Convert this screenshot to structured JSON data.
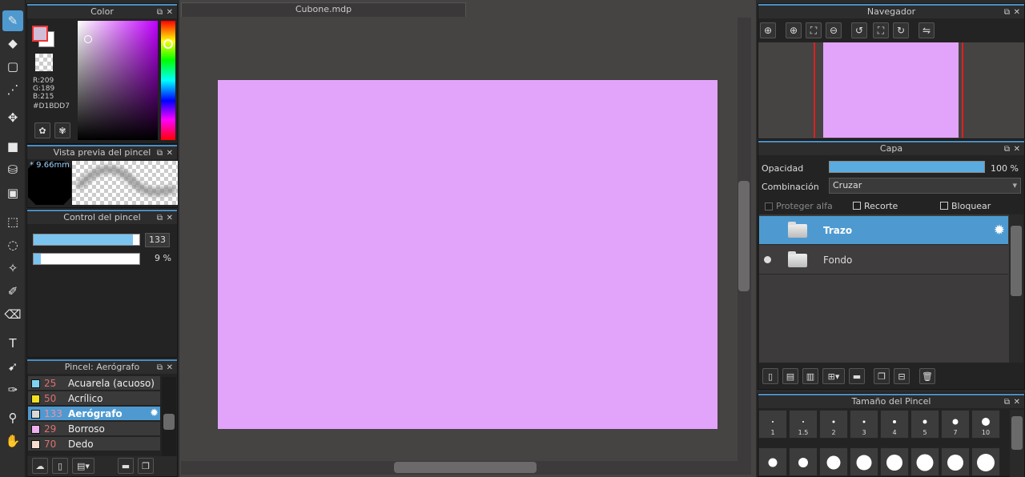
{
  "tools": [
    {
      "name": "brush-tool",
      "icon": "brush-icon",
      "glyph": "✎",
      "active": true
    },
    {
      "name": "eraser-tool",
      "icon": "eraser-icon",
      "glyph": "◆",
      "active": false
    },
    {
      "name": "shape-tool",
      "icon": "rectangle-icon",
      "glyph": "▢",
      "active": false
    },
    {
      "name": "line-tool",
      "icon": "dotted-line-icon",
      "glyph": "⋰",
      "active": false
    },
    {
      "name": "move-tool",
      "icon": "move-icon",
      "glyph": "✥",
      "active": false
    },
    {
      "name": "fill-rect-tool",
      "icon": "filled-square-icon",
      "glyph": "■",
      "active": false
    },
    {
      "name": "bucket-tool",
      "icon": "paint-bucket-icon",
      "glyph": "⛁",
      "active": false
    },
    {
      "name": "gradient-tool",
      "icon": "gradient-icon",
      "glyph": "▣",
      "active": false
    },
    {
      "name": "select-rect-tool",
      "icon": "rect-select-icon",
      "glyph": "⬚",
      "active": false
    },
    {
      "name": "lasso-tool",
      "icon": "lasso-icon",
      "glyph": "◌",
      "active": false
    },
    {
      "name": "magic-wand-tool",
      "icon": "magic-wand-icon",
      "glyph": "✧",
      "active": false
    },
    {
      "name": "select-pen-tool",
      "icon": "select-pen-icon",
      "glyph": "✐",
      "active": false
    },
    {
      "name": "select-eraser-tool",
      "icon": "select-eraser-icon",
      "glyph": "⌫",
      "active": false
    },
    {
      "name": "text-tool",
      "icon": "text-icon",
      "glyph": "T",
      "active": false
    },
    {
      "name": "operation-tool",
      "icon": "pointer-icon",
      "glyph": "➹",
      "active": false
    },
    {
      "name": "eyedropper-tool",
      "icon": "eyedropper-icon",
      "glyph": "✑",
      "active": false
    },
    {
      "name": "dropper-tool",
      "icon": "dropper-icon",
      "glyph": "⚲",
      "active": false
    },
    {
      "name": "hand-tool",
      "icon": "hand-icon",
      "glyph": "✋",
      "active": false
    }
  ],
  "color_panel": {
    "title": "Color",
    "r": "R:209",
    "g": "G:189",
    "b": "B:215",
    "hex": "#D1BDD7",
    "foreground": "#d1bdd7",
    "background": "#ffffff"
  },
  "brush_preview": {
    "title": "Vista previa del pincel",
    "size": "* 9.66mm"
  },
  "brush_control": {
    "title": "Control del pincel",
    "size_value": "133",
    "size_fraction": 0.97,
    "opacity_value": "9 %",
    "opacity_fraction": 0.09
  },
  "brush_list": {
    "title": "Pincel: Aerógrafo",
    "items": [
      {
        "size": "25",
        "name": "Acuarela (acuoso)",
        "color": "#7fd3f0",
        "selected": false
      },
      {
        "size": "50",
        "name": "Acrílico",
        "color": "#f0e020",
        "selected": false
      },
      {
        "size": "133",
        "name": "Aerógrafo",
        "color": "#d8d8d8",
        "selected": true
      },
      {
        "size": "29",
        "name": "Borroso",
        "color": "#f0b0f0",
        "selected": false
      },
      {
        "size": "70",
        "name": "Dedo",
        "color": "#f5ddd0",
        "selected": false
      }
    ]
  },
  "document": {
    "tab": "Cubone.mdp",
    "canvas_color": "#e2a3fb"
  },
  "navigator": {
    "title": "Navegador"
  },
  "layer_panel": {
    "title": "Capa",
    "opacity_label": "Opacidad",
    "opacity_value": "100 %",
    "opacity_fraction": 1.0,
    "blend_label": "Combinación",
    "blend_value": "Cruzar",
    "protect_alpha": "Proteger alfa",
    "clipping": "Recorte",
    "lock": "Bloquear",
    "layers": [
      {
        "name": "Trazo",
        "selected": true
      },
      {
        "name": "Fondo",
        "selected": false
      }
    ]
  },
  "brush_size_panel": {
    "title": "Tamaño del Pincel",
    "sizes": [
      "1",
      "1.5",
      "2",
      "3",
      "4",
      "5",
      "7",
      "10"
    ]
  },
  "colors": {
    "accent": "#4e9ad0",
    "panel": "#232323",
    "workspace": "#464343"
  }
}
